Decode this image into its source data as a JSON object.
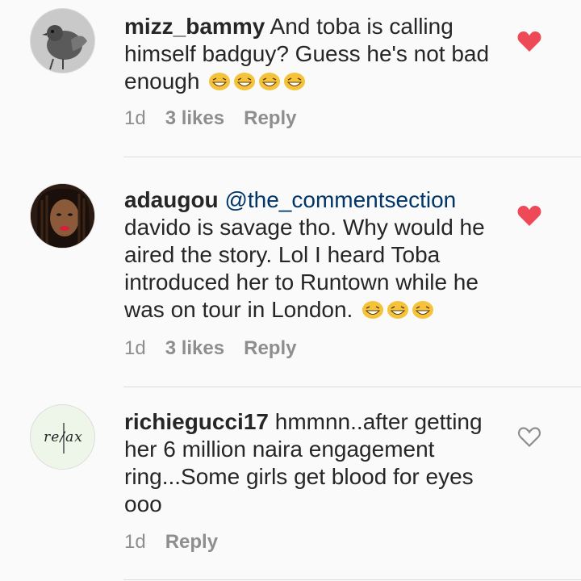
{
  "comments": [
    {
      "username": "mizz_bammy",
      "mention": "",
      "text": "And toba is calling himself badguy? Guess he's not bad enough",
      "emoji": [
        "grinning-squinting-face",
        "grinning-squinting-face",
        "grinning-squinting-face",
        "grinning-squinting-face"
      ],
      "age": "1d",
      "likes": "3 likes",
      "reply": "Reply",
      "liked": true,
      "avatar": "pigeon-photo"
    },
    {
      "username": "adaugou",
      "mention": "@the_commentsection",
      "text": "davido is savage tho. Why would he aired the story. Lol I heard Toba introduced her to Runtown while he was on tour in London.",
      "emoji": [
        "grinning-squinting-face",
        "grinning-squinting-face",
        "grinning-squinting-face"
      ],
      "age": "1d",
      "likes": "3 likes",
      "reply": "Reply",
      "liked": true,
      "avatar": "woman-portrait"
    },
    {
      "username": "richiegucci17",
      "mention": "",
      "text": "hmmnn..after getting her 6 million naira engagement ring...Some girls get blood for eyes ooo",
      "emoji": [],
      "age": "1d",
      "likes": "",
      "reply": "Reply",
      "liked": false,
      "avatar": "relax-logo",
      "avatar_text": "re/ax"
    }
  ],
  "colors": {
    "heart_liked": "#ed4956",
    "heart_outline": "#8e8e8e",
    "mention": "#003569",
    "meta": "#8e8e8e"
  }
}
